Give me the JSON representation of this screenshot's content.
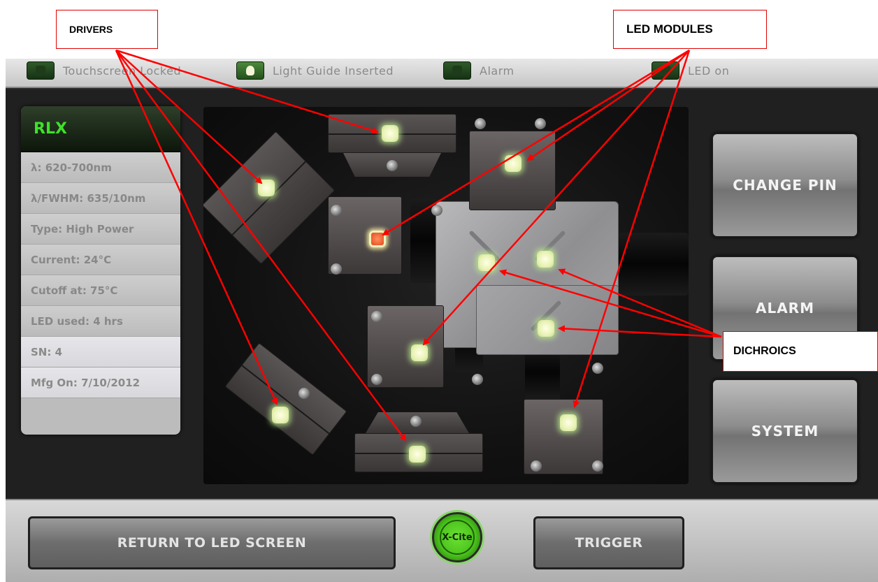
{
  "status": {
    "touchscreen_locked": "Touchscreen Locked",
    "light_guide_inserted": "Light Guide Inserted",
    "alarm": "Alarm",
    "led_on": "LED on"
  },
  "info_panel": {
    "name": "RLX",
    "rows": [
      "λ: 620-700nm",
      "λ/FWHM: 635/10nm",
      "Type: High Power",
      "Current: 24°C",
      "Cutoff at: 75°C",
      "LED used: 4 hrs",
      "SN: 4",
      "Mfg On: 7/10/2012"
    ]
  },
  "side_buttons": {
    "change_pin": "CHANGE PIN",
    "alarm": "ALARM",
    "system": "SYSTEM"
  },
  "bottom": {
    "return": "RETURN TO LED SCREEN",
    "logo": "X-Cite",
    "trigger": "TRIGGER"
  },
  "annotations": {
    "drivers": "DRIVERS",
    "led_modules": "LED MODULES",
    "dichroics": "DICHROICS"
  },
  "colors": {
    "header_green": "#3fe12a",
    "callout_border": "#e00000",
    "arrow_red": "#ff0000",
    "active_led": "#e9582a",
    "led_glow": "#e8f2b4"
  }
}
